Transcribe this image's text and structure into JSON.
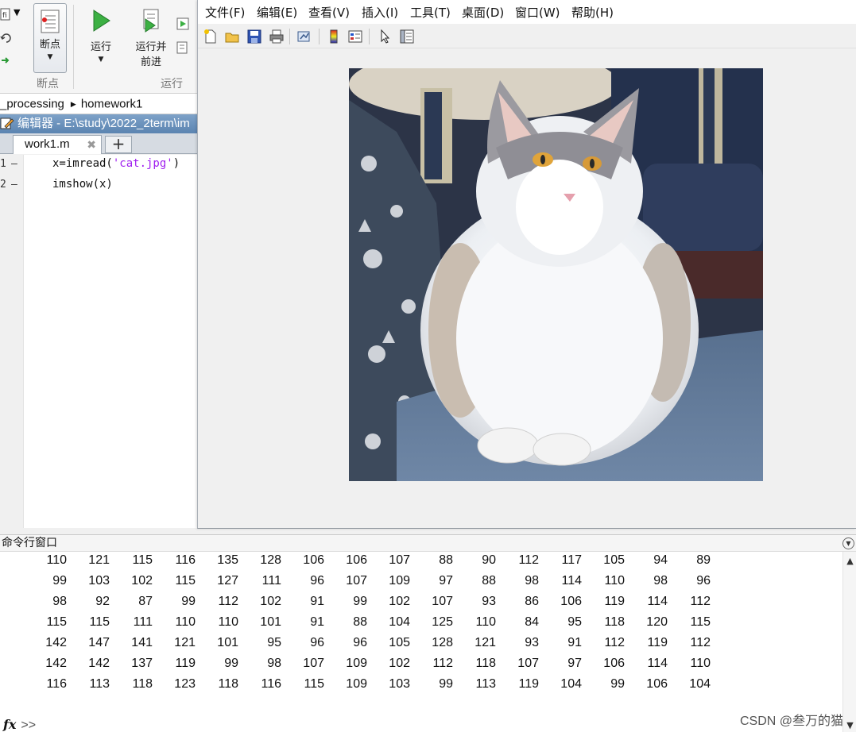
{
  "ribbon": {
    "breakpoints_label": "断点",
    "run_label": "运行",
    "run_advance_label": "运行并\n前进",
    "breakpoints_group": "断点",
    "run_group": "运行"
  },
  "breadcrumb": {
    "items": [
      "_processing",
      "homework1"
    ]
  },
  "editor": {
    "title": "编辑器 - E:\\study\\2022_2term\\im",
    "tab_label": "work1.m",
    "lines": [
      {
        "num": "1",
        "code": "x=imread('cat.jpg')"
      },
      {
        "num": "2",
        "code": "imshow(x)"
      }
    ]
  },
  "figure": {
    "menu": [
      "文件(F)",
      "编辑(E)",
      "查看(V)",
      "插入(I)",
      "工具(T)",
      "桌面(D)",
      "窗口(W)",
      "帮助(H)"
    ],
    "toolbar_icons": [
      "new-figure-icon",
      "open-file-icon",
      "save-icon",
      "print-icon",
      "link-plot-icon",
      "colorbar-icon",
      "legend-icon",
      "edit-plot-arrow-icon",
      "property-inspector-icon"
    ],
    "image_subject": "photo of a white and grey long-haired cat sitting on a blue sofa"
  },
  "command_window": {
    "title": "命令行窗口",
    "prompt": ">>",
    "matrix": [
      [
        110,
        121,
        115,
        116,
        135,
        128,
        106,
        106,
        107,
        88,
        90,
        112,
        117,
        105,
        94,
        89
      ],
      [
        99,
        103,
        102,
        115,
        127,
        111,
        96,
        107,
        109,
        97,
        88,
        98,
        114,
        110,
        98,
        96
      ],
      [
        98,
        92,
        87,
        99,
        112,
        102,
        91,
        99,
        102,
        107,
        93,
        86,
        106,
        119,
        114,
        112
      ],
      [
        115,
        115,
        111,
        110,
        110,
        101,
        91,
        88,
        104,
        125,
        110,
        84,
        95,
        118,
        120,
        115
      ],
      [
        142,
        147,
        141,
        121,
        101,
        95,
        96,
        96,
        105,
        128,
        121,
        93,
        91,
        112,
        119,
        112
      ],
      [
        142,
        142,
        137,
        119,
        99,
        98,
        107,
        109,
        102,
        112,
        118,
        107,
        97,
        106,
        114,
        110
      ],
      [
        116,
        113,
        118,
        123,
        118,
        116,
        115,
        109,
        103,
        99,
        113,
        119,
        104,
        99,
        106,
        104
      ]
    ]
  },
  "watermark": "CSDN @叁万的猫",
  "colors": {
    "editor_title_bg": "#5b84b1",
    "string_literal": "#a020f0",
    "cursor_highlight": "#ffe7a8"
  }
}
